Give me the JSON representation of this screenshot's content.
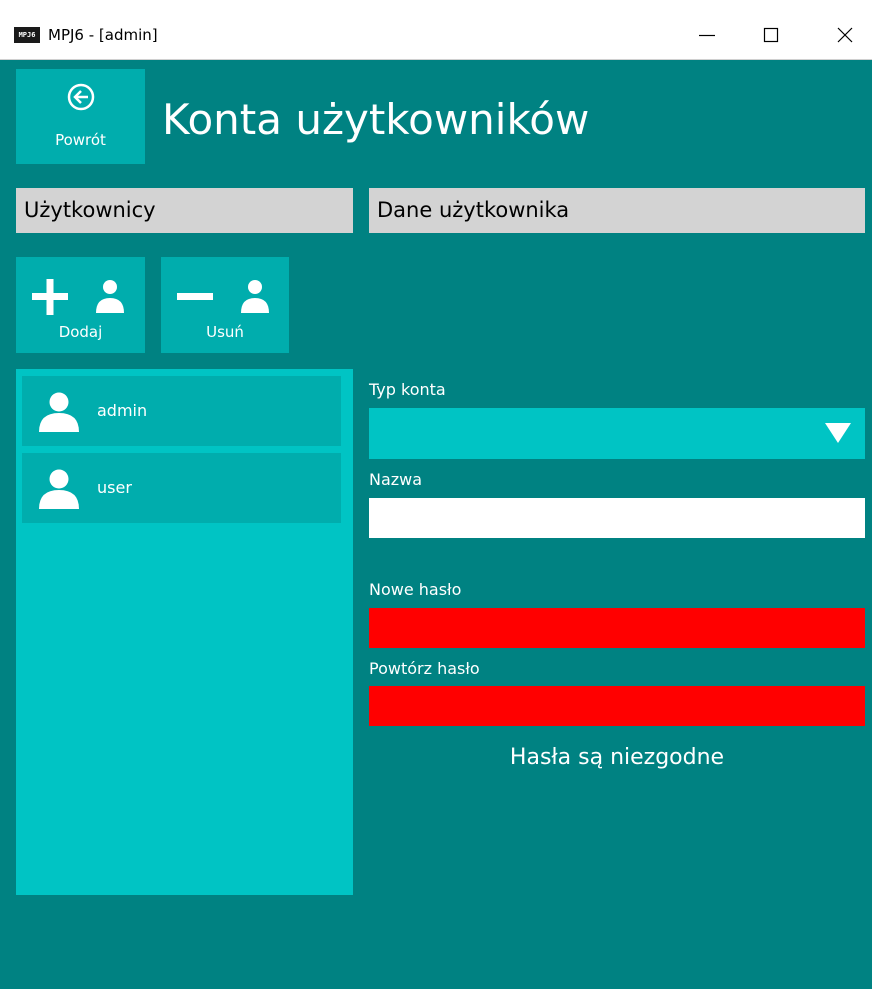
{
  "window": {
    "app_icon_text": "MPJ6",
    "title": "MPJ6 - [admin]"
  },
  "header": {
    "back_label": "Powrót",
    "page_title": "Konta użytkowników"
  },
  "users_panel": {
    "header": "Użytkownicy",
    "add_label": "Dodaj",
    "remove_label": "Usuń",
    "users": [
      {
        "name": "admin"
      },
      {
        "name": "user"
      }
    ]
  },
  "details_panel": {
    "header": "Dane użytkownika",
    "account_type_label": "Typ konta",
    "account_type_value": "",
    "name_label": "Nazwa",
    "name_value": "",
    "new_password_label": "Nowe hasło",
    "repeat_password_label": "Powtórz hasło",
    "password_message": "Hasła są niezgodne"
  },
  "colors": {
    "background": "#008282",
    "tile": "#00adad",
    "list_background": "#00c4c4",
    "section_header": "#d3d3d3",
    "error_field": "#ff0000"
  }
}
